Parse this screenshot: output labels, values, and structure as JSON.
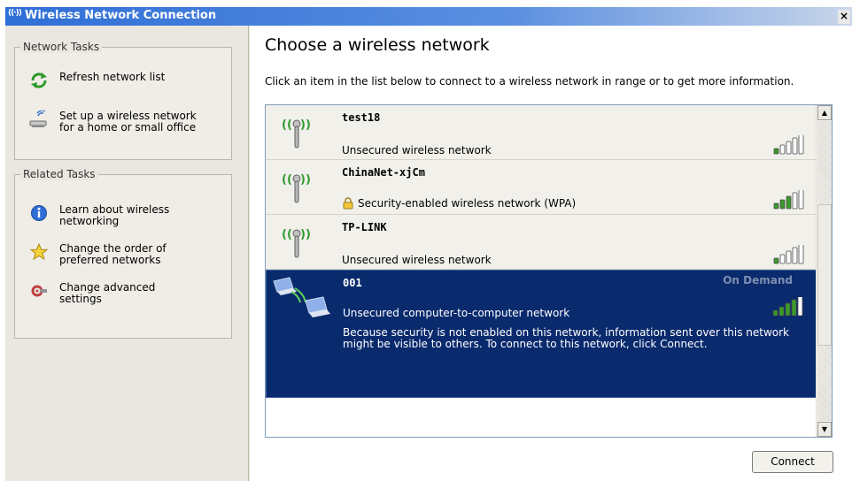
{
  "window": {
    "title": "Wireless Network Connection",
    "close_label": "×"
  },
  "left": {
    "network_tasks": {
      "legend": "Network Tasks",
      "items": [
        {
          "label_lines": [
            "Refresh network list"
          ],
          "icon": "refresh-icon"
        },
        {
          "label_lines": [
            "Set up a wireless network",
            "for a home or small office"
          ],
          "icon": "setup-network-icon"
        }
      ]
    },
    "related_tasks": {
      "legend": "Related Tasks",
      "items": [
        {
          "label_lines": [
            "Learn about wireless",
            "networking"
          ],
          "icon": "info-icon"
        },
        {
          "label_lines": [
            "Change the order of",
            "preferred networks"
          ],
          "icon": "star-icon"
        },
        {
          "label_lines": [
            "Change advanced",
            "settings"
          ],
          "icon": "settings-icon"
        }
      ]
    }
  },
  "main": {
    "heading": "Choose a wireless network",
    "intro": "Click an item in the list below to connect to a wireless network in range or to get more information.",
    "networks": [
      {
        "name": "test18",
        "status": "Unsecured wireless network",
        "secured": false,
        "signal_bars": 1,
        "type": "access-point"
      },
      {
        "name": "ChinaNet-xjCm",
        "status": "Security-enabled wireless network (WPA)",
        "secured": true,
        "signal_bars": 3,
        "type": "access-point"
      },
      {
        "name": "TP-LINK",
        "status": "Unsecured wireless network",
        "secured": false,
        "signal_bars": 1,
        "type": "access-point"
      },
      {
        "name": "001",
        "status": "Unsecured computer-to-computer network",
        "secured": false,
        "signal_bars": 4,
        "type": "ad-hoc",
        "badge": "On Demand",
        "description": "Because security is not enabled on this network, information sent over this network might be visible to others. To connect to this network, click Connect."
      }
    ],
    "connect_label": "Connect"
  },
  "colors": {
    "selected_bg": "#0a2a6e",
    "signal_on": "#3a9a2a",
    "titlebar": "#2f6fd6"
  }
}
